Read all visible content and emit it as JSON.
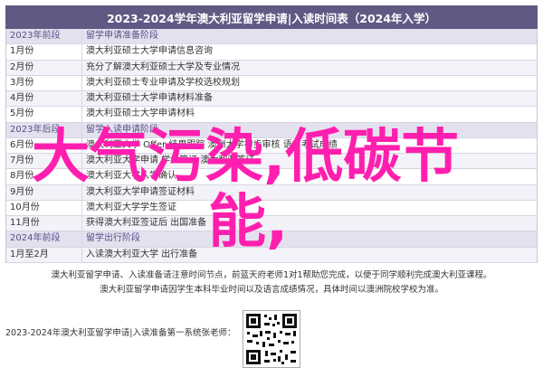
{
  "title": "2023-2024学年澳大利亚留学申请|入读时间表（2024年入学）",
  "rows": [
    {
      "kind": "section",
      "month": "2023年前段",
      "event": "留学申请准备阶段"
    },
    {
      "kind": "normal",
      "month": "1月份",
      "event": "澳大利亚硕士大学申请信息咨询"
    },
    {
      "kind": "normal",
      "month": "2月份",
      "event": "充分了解澳大利亚硕士大学及专业情况"
    },
    {
      "kind": "normal",
      "month": "3月份",
      "event": "澳大利亚硕士专业申请及学校选校规划"
    },
    {
      "kind": "normal",
      "month": "4月份",
      "event": "澳大利亚硕士大学申请材料准备"
    },
    {
      "kind": "normal",
      "month": "5月份",
      "event": "澳大利亚硕士大学申请材料"
    },
    {
      "kind": "section",
      "month": "2023年后段",
      "event": "留学入读申请阶段"
    },
    {
      "kind": "normal",
      "month": "6月份",
      "event": "澳大利亚大学 Offer 结果跟踪  澳洲大学初步审核  语言考试成绩"
    },
    {
      "kind": "normal",
      "month": "7月份",
      "event": "澳大利亚大学申请  学生签证  澳大利亚签证"
    },
    {
      "kind": "normal",
      "month": "8月份",
      "event": "澳大利亚大学入学确认"
    },
    {
      "kind": "normal",
      "month": "9月份",
      "event": "澳大利亚大学申请签证材料"
    },
    {
      "kind": "normal",
      "month": "10月份",
      "event": "澳大利亚大学学生签证"
    },
    {
      "kind": "normal",
      "month": "11月份",
      "event": "获得澳大利亚签证后  出国准备"
    },
    {
      "kind": "section",
      "month": "2024年前段",
      "event": "留学出行阶段"
    },
    {
      "kind": "normal",
      "month": "1月至2月",
      "event": "入读澳大利亚大学  出行准备"
    }
  ],
  "notes": [
    "澳大利亚留学申请、入读准备请注意时间节点，前蓝天府老师1对1帮助您完成，以便于同学顺利完成澳大利亚课程。",
    "澳大利亚留学申请因学生本科毕业时间以及语言成绩情况，具体时间以澳洲院校学校为准。"
  ],
  "footer": "2023-2024年澳大利亚留学申请|入读准备第一系统张老师：",
  "overlay": {
    "line1": "大气污染,低碳节",
    "line2": "能,"
  },
  "colors": {
    "header_bg": "#5f5a83",
    "overlay_text": "#ff1fae"
  }
}
